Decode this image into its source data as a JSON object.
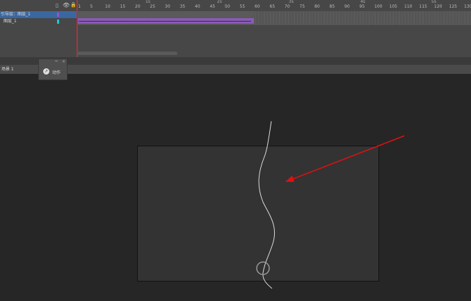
{
  "timeline": {
    "seconds": [
      "1s",
      "2s",
      "3s",
      "4s",
      "5s"
    ],
    "frames": [
      "1",
      "5",
      "10",
      "15",
      "20",
      "25",
      "30",
      "35",
      "40",
      "45",
      "50",
      "55",
      "60",
      "65",
      "70",
      "75",
      "80",
      "85",
      "90",
      "95",
      "100",
      "105",
      "110",
      "115",
      "120",
      "125",
      "130"
    ],
    "layers": [
      {
        "name": "引导层：图层_1",
        "color": "#9b4fd0"
      },
      {
        "name": "图层_1",
        "color": "#1ec8d8"
      }
    ]
  },
  "scene": {
    "label": "场景 1"
  },
  "actions_panel": {
    "label": "动作"
  },
  "colors": {
    "arrow": "#e01010",
    "tween": "#8a5bb5"
  }
}
